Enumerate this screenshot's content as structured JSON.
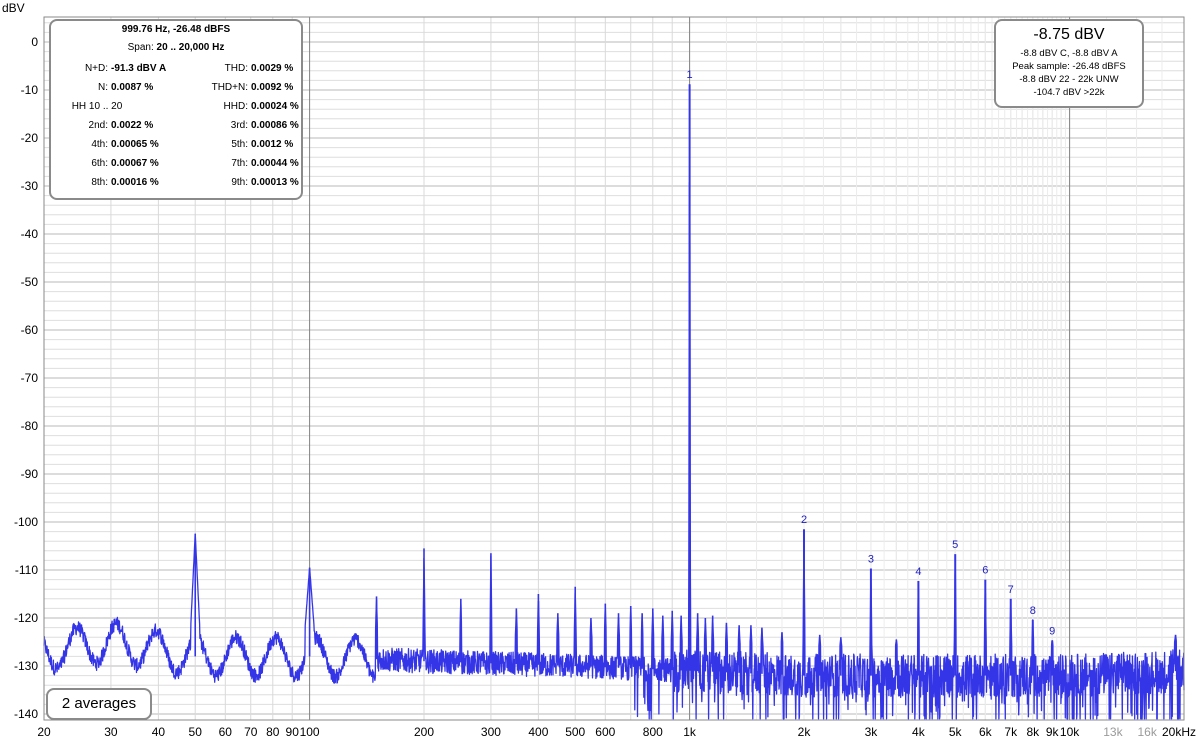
{
  "colors": {
    "trace": "#3535e8",
    "harmonic_label": "#2020c0",
    "grid_minor": "#d9d9d9",
    "grid_major": "#8a8a8a",
    "box_border": "#8a8a8a"
  },
  "stats_box": {
    "freq_line": "999.76 Hz, -26.48 dBFS",
    "span_label": "Span:",
    "span_value": "20 .. 20,000 Hz",
    "rows": [
      [
        {
          "label": "N+D:",
          "value": "-91.3 dBV A"
        },
        {
          "label": "THD:",
          "value": "0.0029 %"
        }
      ],
      [
        {
          "label": "N:",
          "value": "0.0087 %"
        },
        {
          "label": "THD+N:",
          "value": "0.0092 %"
        }
      ],
      [
        {
          "label": "HH 10 .. 20",
          "value": ""
        },
        {
          "label": "HHD:",
          "value": "0.00024 %"
        }
      ],
      [
        {
          "label": "2nd:",
          "value": "0.0022 %"
        },
        {
          "label": "3rd:",
          "value": "0.00086 %"
        }
      ],
      [
        {
          "label": "4th:",
          "value": "0.00065 %"
        },
        {
          "label": "5th:",
          "value": "0.0012 %"
        }
      ],
      [
        {
          "label": "6th:",
          "value": "0.00067 %"
        },
        {
          "label": "7th:",
          "value": "0.00044 %"
        }
      ],
      [
        {
          "label": "8th:",
          "value": "0.00016 %"
        },
        {
          "label": "9th:",
          "value": "0.00013 %"
        }
      ]
    ]
  },
  "level_box": {
    "main": "-8.75 dBV",
    "lines": [
      "-8.8 dBV C, -8.8 dBV A",
      "Peak sample: -26.48 dBFS",
      "-8.8 dBV 22 - 22k UNW",
      "-104.7 dBV >22k"
    ]
  },
  "averages_label": "2 averages",
  "chart_data": {
    "type": "line",
    "xscale": "log",
    "ylabel": "dBV",
    "xlim": [
      20,
      20000
    ],
    "ylim": [
      -140,
      5
    ],
    "grid": true,
    "y_ticks": [
      0,
      -10,
      -20,
      -30,
      -40,
      -50,
      -60,
      -70,
      -80,
      -90,
      -100,
      -110,
      -120,
      -130,
      -140
    ],
    "x_ticks": [
      {
        "value": 20,
        "label": "20"
      },
      {
        "value": 30,
        "label": "30"
      },
      {
        "value": 40,
        "label": "40"
      },
      {
        "value": 50,
        "label": "50"
      },
      {
        "value": 60,
        "label": "60"
      },
      {
        "value": 70,
        "label": "70"
      },
      {
        "value": 80,
        "label": "80"
      },
      {
        "value": 90,
        "label": "90"
      },
      {
        "value": 100,
        "label": "100"
      },
      {
        "value": 200,
        "label": "200"
      },
      {
        "value": 300,
        "label": "300"
      },
      {
        "value": 400,
        "label": "400"
      },
      {
        "value": 500,
        "label": "500"
      },
      {
        "value": 600,
        "label": "600"
      },
      {
        "value": 800,
        "label": "800"
      },
      {
        "value": 1000,
        "label": "1k"
      },
      {
        "value": 2000,
        "label": "2k"
      },
      {
        "value": 3000,
        "label": "3k"
      },
      {
        "value": 4000,
        "label": "4k"
      },
      {
        "value": 5000,
        "label": "5k"
      },
      {
        "value": 6000,
        "label": "6k"
      },
      {
        "value": 7000,
        "label": "7k"
      },
      {
        "value": 8000,
        "label": "8k"
      },
      {
        "value": 9000,
        "label": "9k"
      },
      {
        "value": 10000,
        "label": "10k"
      },
      {
        "value": 13000,
        "label": "13k",
        "faint": true
      },
      {
        "value": 16000,
        "label": "16k",
        "faint": true
      },
      {
        "value": 20000,
        "label": "20kHz"
      }
    ],
    "harmonics": [
      {
        "n": "1",
        "freq": 1000,
        "level": -8.8
      },
      {
        "n": "2",
        "freq": 2000,
        "level": -101.5
      },
      {
        "n": "3",
        "freq": 3000,
        "level": -109.7
      },
      {
        "n": "4",
        "freq": 4000,
        "level": -112.3
      },
      {
        "n": "5",
        "freq": 5000,
        "level": -106.7
      },
      {
        "n": "6",
        "freq": 6000,
        "level": -112.0
      },
      {
        "n": "7",
        "freq": 7000,
        "level": -116.0
      },
      {
        "n": "8",
        "freq": 8000,
        "level": -120.4
      },
      {
        "n": "9",
        "freq": 9000,
        "level": -124.7
      }
    ],
    "spurs": [
      {
        "freq": 50,
        "level": -102.5
      },
      {
        "freq": 100,
        "level": -109.5
      },
      {
        "freq": 150,
        "level": -115.5
      },
      {
        "freq": 200,
        "level": -105.5
      },
      {
        "freq": 250,
        "level": -116.0
      },
      {
        "freq": 300,
        "level": -106.5
      },
      {
        "freq": 350,
        "level": -118.0
      },
      {
        "freq": 400,
        "level": -115.0
      },
      {
        "freq": 450,
        "level": -119.0
      },
      {
        "freq": 500,
        "level": -113.5
      },
      {
        "freq": 550,
        "level": -120.0
      },
      {
        "freq": 600,
        "level": -117.0
      },
      {
        "freq": 650,
        "level": -119.0
      },
      {
        "freq": 700,
        "level": -117.5
      },
      {
        "freq": 750,
        "level": -119.0
      },
      {
        "freq": 800,
        "level": -118.0
      },
      {
        "freq": 850,
        "level": -119.5
      },
      {
        "freq": 900,
        "level": -118.5
      },
      {
        "freq": 950,
        "level": -119.5
      },
      {
        "freq": 1050,
        "level": -119.0
      },
      {
        "freq": 1100,
        "level": -120.0
      },
      {
        "freq": 1150,
        "level": -119.5
      },
      {
        "freq": 1250,
        "level": -121.0
      },
      {
        "freq": 1350,
        "level": -121.5
      },
      {
        "freq": 1450,
        "level": -121.5
      },
      {
        "freq": 1550,
        "level": -122.0
      },
      {
        "freq": 1750,
        "level": -123.0
      },
      {
        "freq": 2200,
        "level": -123.5
      },
      {
        "freq": 2500,
        "level": -124.0
      },
      {
        "freq": 3500,
        "level": -124.5
      },
      {
        "freq": 19000,
        "level": -123.5
      }
    ],
    "noise_floor": [
      {
        "freq": 20,
        "level": -127
      },
      {
        "freq": 30,
        "level": -125
      },
      {
        "freq": 50,
        "level": -128
      },
      {
        "freq": 100,
        "level": -128
      },
      {
        "freq": 200,
        "level": -129
      },
      {
        "freq": 500,
        "level": -130
      },
      {
        "freq": 1000,
        "level": -131
      },
      {
        "freq": 2000,
        "level": -132
      },
      {
        "freq": 5000,
        "level": -132
      },
      {
        "freq": 10000,
        "level": -132
      },
      {
        "freq": 20000,
        "level": -131
      }
    ]
  }
}
